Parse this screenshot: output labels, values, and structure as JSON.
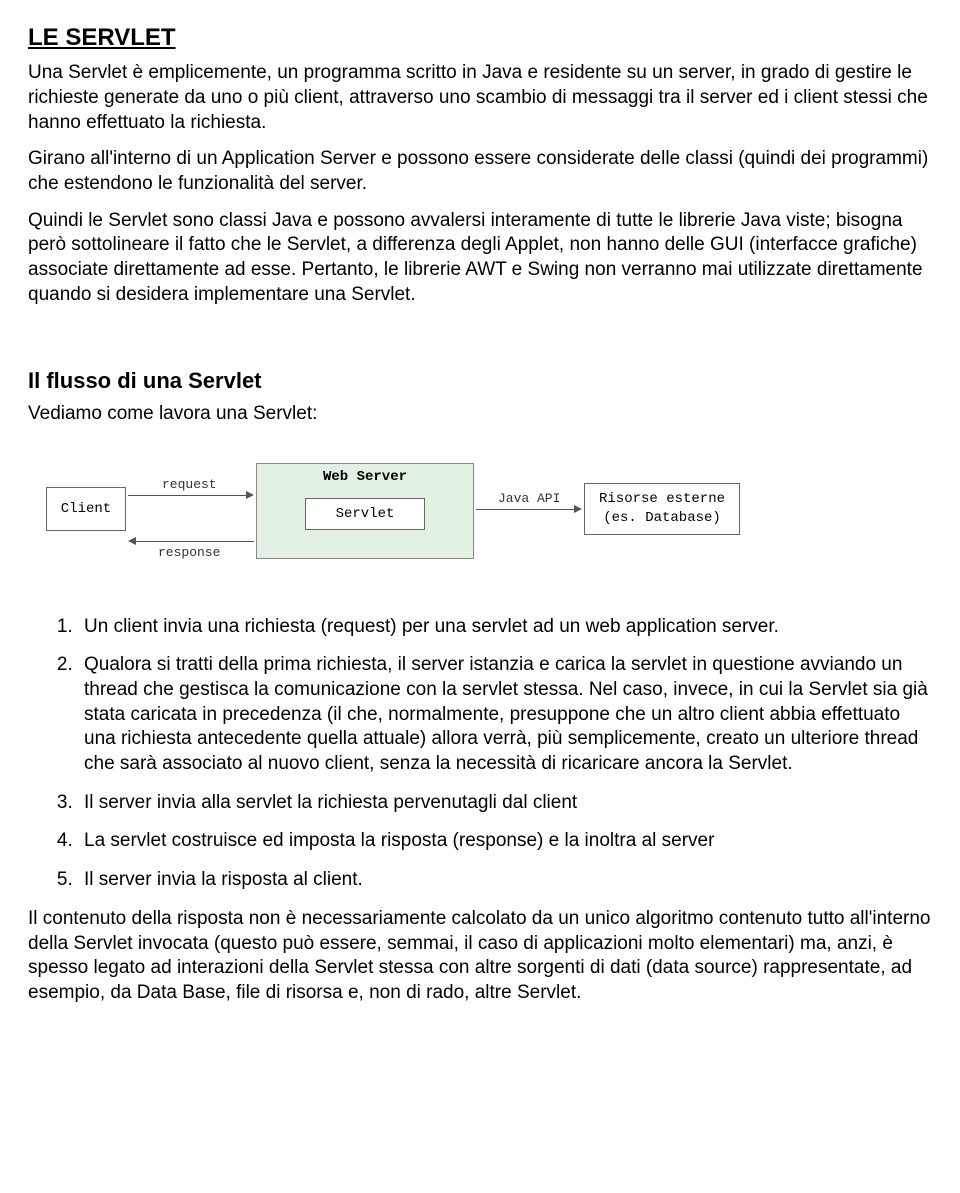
{
  "title": "LE SERVLET",
  "para1": "Una Servlet è emplicemente, un programma scritto in Java e residente su un server, in grado di gestire le richieste generate da uno o più client, attraverso uno scambio di messaggi tra il server ed i client stessi che hanno effettuato la richiesta.",
  "para2": "Girano all'interno di un Application Server e possono essere considerate delle classi (quindi dei programmi) che estendono le funzionalità del server.",
  "para3": "Quindi le Servlet sono classi Java e possono avvalersi interamente di tutte le librerie Java viste; bisogna però sottolineare il fatto che le Servlet, a differenza degli Applet, non hanno delle GUI (interfacce grafiche) associate direttamente ad esse. Pertanto, le librerie AWT e Swing non verranno mai utilizzate direttamente quando si desidera implementare una Servlet.",
  "heading2": "Il flusso di una Servlet",
  "subpara": "Vediamo come lavora una Servlet:",
  "diagram": {
    "client": "Client",
    "webserver": "Web Server",
    "servlet": "Servlet",
    "external1": "Risorse esterne",
    "external2": "(es. Database)",
    "request": "request",
    "response": "response",
    "javaapi": "Java API"
  },
  "list": {
    "i1": "Un client invia una richiesta (request) per una servlet ad un web application server.",
    "i2": "Qualora si tratti della prima richiesta, il server istanzia e carica la servlet in questione avviando un thread che gestisca la comunicazione con la servlet stessa. Nel caso, invece, in cui la Servlet sia già stata caricata in precedenza (il che, normalmente, presuppone che un altro client abbia effettuato una richiesta antecedente quella attuale) allora verrà, più semplicemente, creato un ulteriore thread che sarà associato al nuovo client, senza la necessità di ricaricare ancora la Servlet.",
    "i3": "Il server invia alla servlet la richiesta pervenutagli dal client",
    "i4": "La servlet costruisce ed imposta la risposta (response) e la inoltra al server",
    "i5": "Il server invia la risposta al client."
  },
  "closing": "Il contenuto della risposta non è necessariamente calcolato da un unico algoritmo contenuto tutto all'interno della Servlet invocata (questo può essere, semmai, il caso di applicazioni molto elementari) ma, anzi, è spesso legato ad interazioni della Servlet stessa con altre sorgenti di dati (data source) rappresentate, ad esempio, da Data Base, file di risorsa e, non di rado, altre Servlet."
}
